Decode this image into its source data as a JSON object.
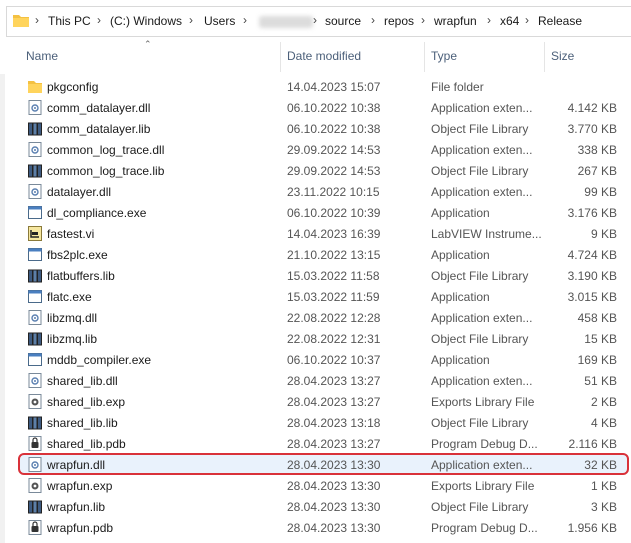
{
  "breadcrumb": [
    "This PC",
    "(C:) Windows",
    "Users",
    "source",
    "repos",
    "wrapfun",
    "x64",
    "Release"
  ],
  "columns": {
    "name": "Name",
    "date": "Date modified",
    "type": "Type",
    "size": "Size"
  },
  "files": [
    {
      "name": "pkgconfig",
      "date": "14.04.2023 15:07",
      "type": "File folder",
      "size": "",
      "icon": "folder-icon"
    },
    {
      "name": "comm_datalayer.dll",
      "date": "06.10.2022 10:38",
      "type": "Application exten...",
      "size": "4.142 KB",
      "icon": "dll-file-icon"
    },
    {
      "name": "comm_datalayer.lib",
      "date": "06.10.2022 10:38",
      "type": "Object File Library",
      "size": "3.770 KB",
      "icon": "lib-file-icon"
    },
    {
      "name": "common_log_trace.dll",
      "date": "29.09.2022 14:53",
      "type": "Application exten...",
      "size": "338 KB",
      "icon": "dll-file-icon"
    },
    {
      "name": "common_log_trace.lib",
      "date": "29.09.2022 14:53",
      "type": "Object File Library",
      "size": "267 KB",
      "icon": "lib-file-icon"
    },
    {
      "name": "datalayer.dll",
      "date": "23.11.2022 10:15",
      "type": "Application exten...",
      "size": "99 KB",
      "icon": "dll-file-icon"
    },
    {
      "name": "dl_compliance.exe",
      "date": "06.10.2022 10:39",
      "type": "Application",
      "size": "3.176 KB",
      "icon": "exe-file-icon"
    },
    {
      "name": "fastest.vi",
      "date": "14.04.2023 16:39",
      "type": "LabVIEW Instrume...",
      "size": "9 KB",
      "icon": "labview-file-icon"
    },
    {
      "name": "fbs2plc.exe",
      "date": "21.10.2022 13:15",
      "type": "Application",
      "size": "4.724 KB",
      "icon": "exe-file-icon"
    },
    {
      "name": "flatbuffers.lib",
      "date": "15.03.2022 11:58",
      "type": "Object File Library",
      "size": "3.190 KB",
      "icon": "lib-file-icon"
    },
    {
      "name": "flatc.exe",
      "date": "15.03.2022 11:59",
      "type": "Application",
      "size": "3.015 KB",
      "icon": "exe-file-icon"
    },
    {
      "name": "libzmq.dll",
      "date": "22.08.2022 12:28",
      "type": "Application exten...",
      "size": "458 KB",
      "icon": "dll-file-icon"
    },
    {
      "name": "libzmq.lib",
      "date": "22.08.2022 12:31",
      "type": "Object File Library",
      "size": "15 KB",
      "icon": "lib-file-icon"
    },
    {
      "name": "mddb_compiler.exe",
      "date": "06.10.2022 10:37",
      "type": "Application",
      "size": "169 KB",
      "icon": "exe-file-icon"
    },
    {
      "name": "shared_lib.dll",
      "date": "28.04.2023 13:27",
      "type": "Application exten...",
      "size": "51 KB",
      "icon": "dll-file-icon"
    },
    {
      "name": "shared_lib.exp",
      "date": "28.04.2023 13:27",
      "type": "Exports Library File",
      "size": "2 KB",
      "icon": "exp-file-icon"
    },
    {
      "name": "shared_lib.lib",
      "date": "28.04.2023 13:18",
      "type": "Object File Library",
      "size": "4 KB",
      "icon": "lib-file-icon"
    },
    {
      "name": "shared_lib.pdb",
      "date": "28.04.2023 13:27",
      "type": "Program Debug D...",
      "size": "2.116 KB",
      "icon": "pdb-file-icon"
    },
    {
      "name": "wrapfun.dll",
      "date": "28.04.2023 13:30",
      "type": "Application exten...",
      "size": "32 KB",
      "icon": "dll-file-icon",
      "highlighted": true
    },
    {
      "name": "wrapfun.exp",
      "date": "28.04.2023 13:30",
      "type": "Exports Library File",
      "size": "1 KB",
      "icon": "exp-file-icon"
    },
    {
      "name": "wrapfun.lib",
      "date": "28.04.2023 13:30",
      "type": "Object File Library",
      "size": "3 KB",
      "icon": "lib-file-icon"
    },
    {
      "name": "wrapfun.pdb",
      "date": "28.04.2023 13:30",
      "type": "Program Debug D...",
      "size": "1.956 KB",
      "icon": "pdb-file-icon"
    }
  ],
  "colors": {
    "highlight_border": "#d9323a",
    "header_text": "#4c607a",
    "folder": "#f4c142"
  }
}
